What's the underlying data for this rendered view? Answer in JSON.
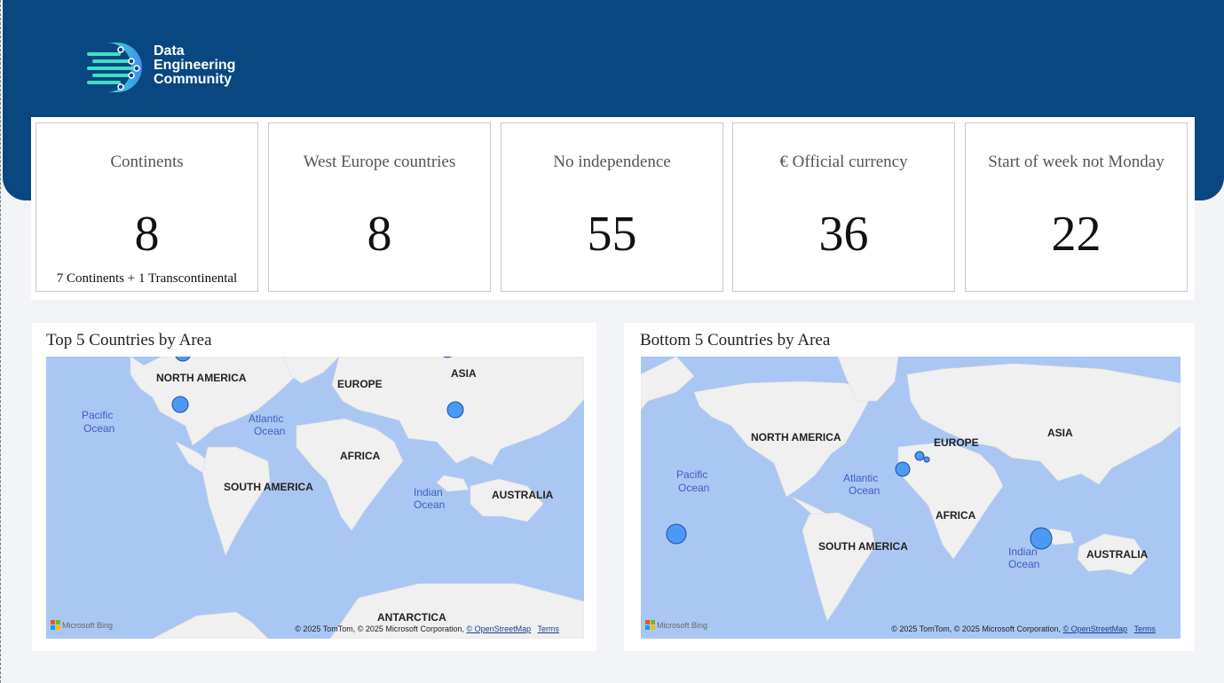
{
  "brand": {
    "line1": "Data",
    "line2": "Engineering",
    "line3": "Community"
  },
  "kpis": [
    {
      "title": "Continents",
      "value": "8",
      "subtitle": "7 Continents + 1 Transcontinental"
    },
    {
      "title": "West Europe countries",
      "value": "8",
      "subtitle": ""
    },
    {
      "title": "No independence",
      "value": "55",
      "subtitle": ""
    },
    {
      "title": "€ Official currency",
      "value": "36",
      "subtitle": ""
    },
    {
      "title": "Start of week not Monday",
      "value": "22",
      "subtitle": ""
    }
  ],
  "maps": {
    "top": {
      "title": "Top 5 Countries by Area",
      "labels": {
        "north_america": "NORTH AMERICA",
        "europe": "EUROPE",
        "asia": "ASIA",
        "africa": "AFRICA",
        "south_america": "SOUTH AMERICA",
        "australia": "AUSTRALIA",
        "antarctica": "ANTARCTICA",
        "pacific_1": "Pacific",
        "pacific_2": "Ocean",
        "atlantic_1": "Atlantic",
        "atlantic_2": "Ocean",
        "indian_1": "Indian",
        "indian_2": "Ocean"
      }
    },
    "bottom": {
      "title": "Bottom 5 Countries by Area",
      "labels": {
        "north_america": "NORTH AMERICA",
        "europe": "EUROPE",
        "asia": "ASIA",
        "africa": "AFRICA",
        "south_america": "SOUTH AMERICA",
        "australia": "AUSTRALIA",
        "pacific_1": "Pacific",
        "pacific_2": "Ocean",
        "atlantic_1": "Atlantic",
        "atlantic_2": "Ocean",
        "indian_1": "Indian",
        "indian_2": "Ocean"
      }
    }
  },
  "attribution": {
    "text": "© 2025 TomTom, © 2025 Microsoft Corporation,",
    "osm_link": "© OpenStreetMap",
    "terms_link": "Terms",
    "bing": "Microsoft Bing"
  },
  "colors": {
    "header": "#094780",
    "ocean": "#aac7f4",
    "land": "#f0f0f0",
    "bubble": "#4a9af5"
  }
}
